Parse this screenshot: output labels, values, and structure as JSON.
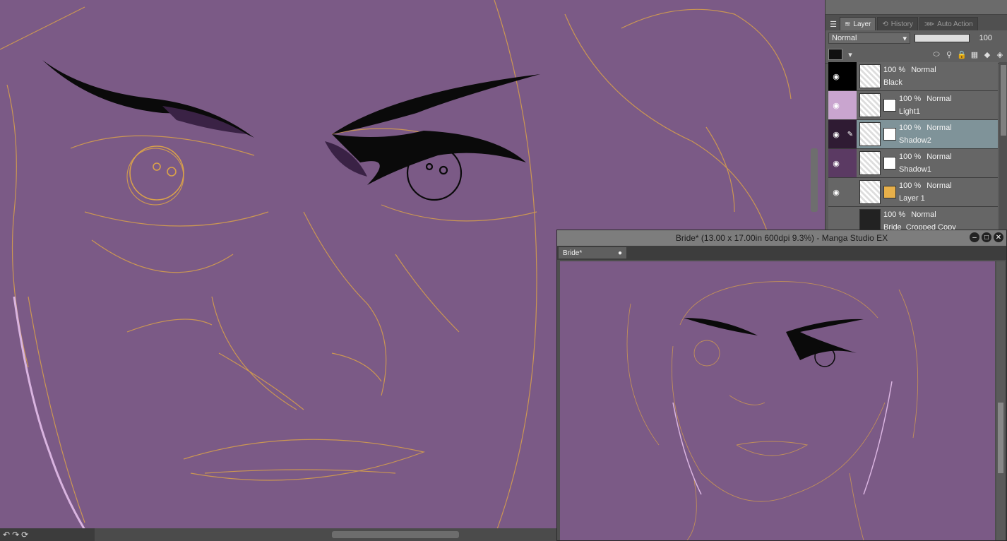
{
  "app": {
    "window_title": "Bride* (13.00 x 17.00in 600dpi 9.3%)  - Manga Studio EX",
    "document_tab": "Bride*"
  },
  "layer_panel": {
    "tabs": [
      {
        "label": "Layer",
        "icon": "layer-icon",
        "active": true
      },
      {
        "label": "History",
        "icon": "history-icon",
        "active": false
      },
      {
        "label": "Auto Action",
        "icon": "auto-action-icon",
        "active": false
      }
    ],
    "blend_mode": "Normal",
    "opacity": "100",
    "layers": [
      {
        "opacity": "100 %",
        "mode": "Normal",
        "name": "Black",
        "visible": true,
        "selected": false,
        "color": "#000000",
        "has_mask": false
      },
      {
        "opacity": "100 %",
        "mode": "Normal",
        "name": "Light1",
        "visible": true,
        "selected": false,
        "color": "#c9a5cf",
        "has_mask": true
      },
      {
        "opacity": "100 %",
        "mode": "Normal",
        "name": "Shadow2",
        "visible": true,
        "selected": true,
        "color": "#2f1b33",
        "has_mask": true
      },
      {
        "opacity": "100 %",
        "mode": "Normal",
        "name": "Shadow1",
        "visible": true,
        "selected": false,
        "color": "#5b3a63",
        "has_mask": true
      },
      {
        "opacity": "100 %",
        "mode": "Normal",
        "name": "Layer 1",
        "visible": true,
        "selected": false,
        "color": "#5e5e5e",
        "has_mask": true
      },
      {
        "opacity": "100 %",
        "mode": "Normal",
        "name": "Bride_Cropped Copy",
        "visible": false,
        "selected": false,
        "color": "#5e5e5e",
        "has_mask": false
      }
    ]
  },
  "colors": {
    "canvas_bg": "#7b5a86",
    "sketch_line": "#d9a14a",
    "ink": "#0a0a0a",
    "shadow": "#3a2245"
  }
}
